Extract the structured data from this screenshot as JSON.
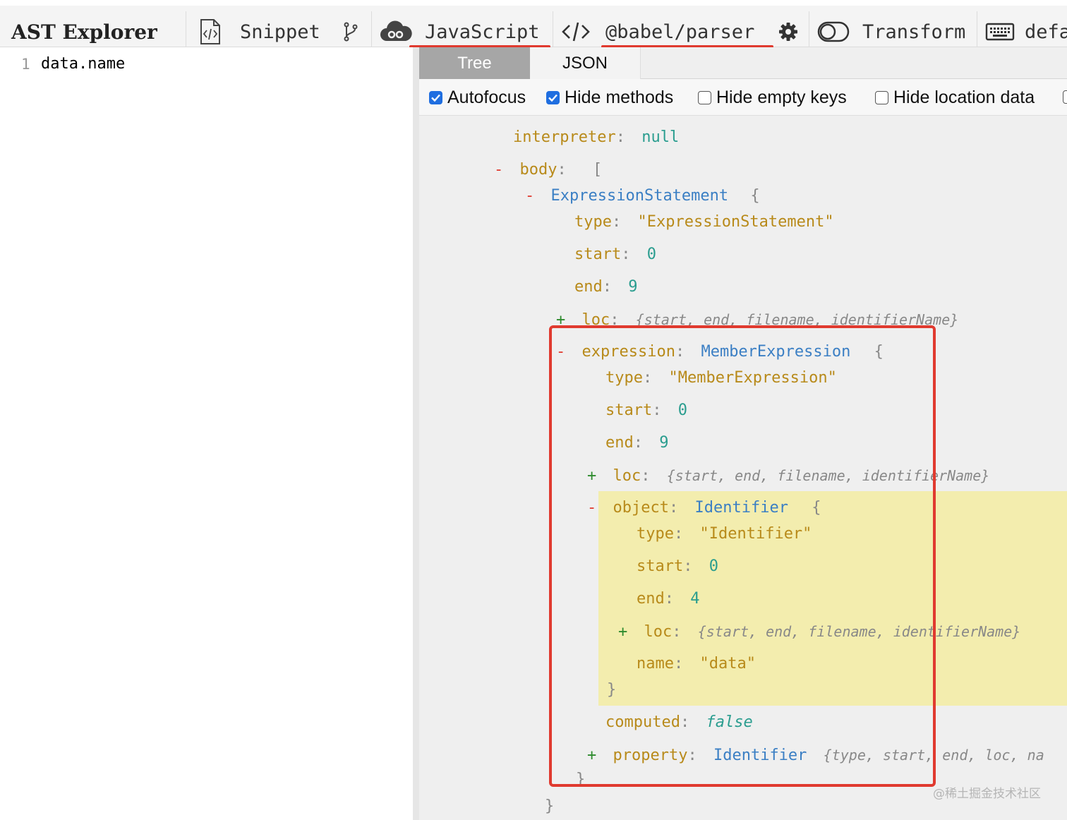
{
  "toolbar": {
    "brand": "AST Explorer",
    "snippet": "Snippet",
    "language": "JavaScript",
    "parser": "@babel/parser",
    "transform": "Transform",
    "default": "defa"
  },
  "editor": {
    "line_number": "1",
    "code": "data.name"
  },
  "tabs": {
    "tree": "Tree",
    "json": "JSON"
  },
  "options": [
    {
      "label": "Autofocus",
      "checked": true
    },
    {
      "label": "Hide methods",
      "checked": true
    },
    {
      "label": "Hide empty keys",
      "checked": false
    },
    {
      "label": "Hide location data",
      "checked": false
    }
  ],
  "tree": {
    "interpreter_key": "interpreter",
    "interpreter_val": "null",
    "body_key": "body",
    "body_open": "[",
    "stmt_type_name": "ExpressionStatement",
    "brace_open": "{",
    "brace_close": "}",
    "type_key": "type",
    "start_key": "start",
    "end_key": "end",
    "loc_key": "loc",
    "stmt_type_val": "\"ExpressionStatement\"",
    "stmt_start": "0",
    "stmt_end": "9",
    "loc_summary": "{start, end, filename, identifierName}",
    "expression_key": "expression",
    "member_type_name": "MemberExpression",
    "member_type_val": "\"MemberExpression\"",
    "member_start": "0",
    "member_end": "9",
    "object_key": "object",
    "ident_type_name": "Identifier",
    "ident_type_val": "\"Identifier\"",
    "obj_start": "0",
    "obj_end": "4",
    "name_key": "name",
    "obj_name": "\"data\"",
    "computed_key": "computed",
    "computed_val": "false",
    "property_key": "property",
    "property_summary": "{type, start, end, loc, na",
    "minus": "-",
    "plus": "+",
    "colon": ":"
  },
  "watermark": "@稀土掘金技术社区",
  "colors": {
    "accent_red": "#e03a2f",
    "checkbox_blue": "#1f6ee0",
    "highlight": "#f3edae"
  }
}
